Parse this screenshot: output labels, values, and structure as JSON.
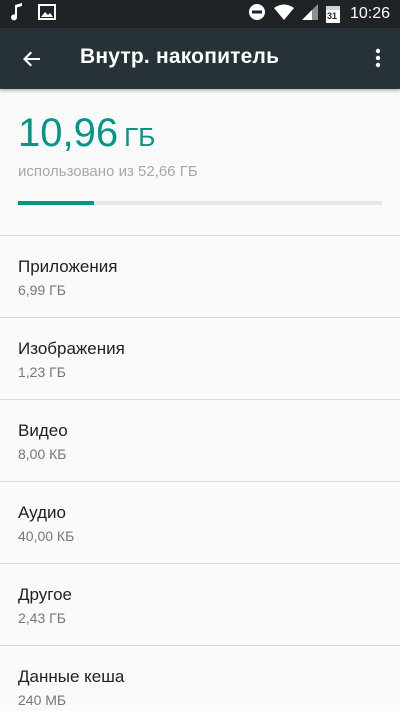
{
  "status_bar": {
    "time": "10:26",
    "calendar_day": "31",
    "icons": [
      "music-note-icon",
      "image-icon",
      "do-not-disturb-icon",
      "wifi-icon",
      "signal-icon",
      "calendar-icon"
    ]
  },
  "app_bar": {
    "title": "Внутр. накопитель",
    "back_icon": "arrow-back-icon",
    "menu_icon": "more-vert-icon"
  },
  "summary": {
    "used_value": "10,96",
    "used_unit": "ГБ",
    "total_text": "использовано из 52,66 ГБ",
    "progress_fraction": 0.208
  },
  "items": [
    {
      "title": "Приложения",
      "size": "6,99 ГБ"
    },
    {
      "title": "Изображения",
      "size": "1,23 ГБ"
    },
    {
      "title": "Видео",
      "size": "8,00 КБ"
    },
    {
      "title": "Аудио",
      "size": "40,00 КБ"
    },
    {
      "title": "Другое",
      "size": "2,43 ГБ"
    },
    {
      "title": "Данные кеша",
      "size": "240 МБ"
    }
  ],
  "colors": {
    "accent": "#009688",
    "app_bar": "#263238",
    "status_bar": "#1e2426"
  }
}
